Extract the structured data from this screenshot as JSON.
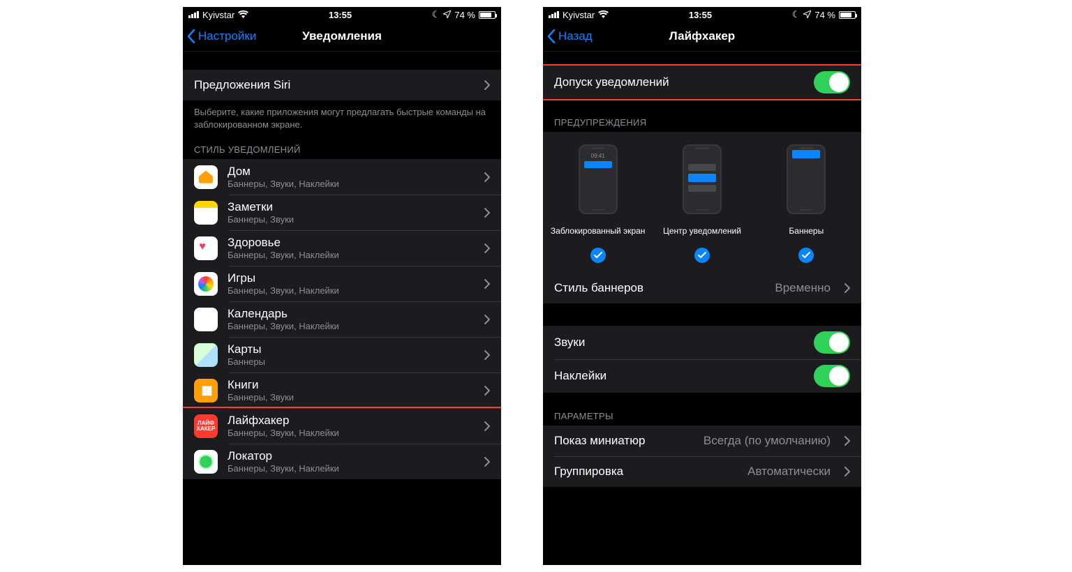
{
  "status": {
    "carrier": "Kyivstar",
    "time": "13:55",
    "battery_text": "74 %"
  },
  "left": {
    "back": "Настройки",
    "title": "Уведомления",
    "siri_row": "Предложения Siri",
    "siri_footer": "Выберите, какие приложения могут предлагать быстрые команды на заблокированном экране.",
    "style_header": "СТИЛЬ УВЕДОМЛЕНИЙ",
    "apps": [
      {
        "name": "Дом",
        "sub": "Баннеры, Звуки, Наклейки",
        "icon": "ic-home"
      },
      {
        "name": "Заметки",
        "sub": "Баннеры, Звуки",
        "icon": "ic-notes"
      },
      {
        "name": "Здоровье",
        "sub": "Баннеры, Звуки, Наклейки",
        "icon": "ic-health"
      },
      {
        "name": "Игры",
        "sub": "Баннеры, Звуки, Наклейки",
        "icon": "ic-games"
      },
      {
        "name": "Календарь",
        "sub": "Баннеры, Звуки, Наклейки",
        "icon": "ic-cal"
      },
      {
        "name": "Карты",
        "sub": "Баннеры",
        "icon": "ic-maps"
      },
      {
        "name": "Книги",
        "sub": "Баннеры, Звуки",
        "icon": "ic-books"
      },
      {
        "name": "Лайфхакер",
        "sub": "Баннеры, Звуки, Наклейки",
        "icon": "ic-lh",
        "icon_text": "ЛАЙФ\nХАКЕР",
        "highlight": true
      },
      {
        "name": "Локатор",
        "sub": "Баннеры, Звуки, Наклейки",
        "icon": "ic-find"
      }
    ]
  },
  "right": {
    "back": "Назад",
    "title": "Лайфхакер",
    "allow": "Допуск уведомлений",
    "alerts_header": "ПРЕДУПРЕЖДЕНИЯ",
    "preview_time": "09:41",
    "lock_label": "Заблокированный экран",
    "nc_label": "Центр уведомлений",
    "banner_label": "Баннеры",
    "banner_style_row": "Стиль баннеров",
    "banner_style_value": "Временно",
    "sounds": "Звуки",
    "badges": "Наклейки",
    "options_header": "ПАРАМЕТРЫ",
    "previews_row": "Показ миниатюр",
    "previews_value": "Всегда (по умолчанию)",
    "grouping_row": "Группировка",
    "grouping_value": "Автоматически"
  }
}
